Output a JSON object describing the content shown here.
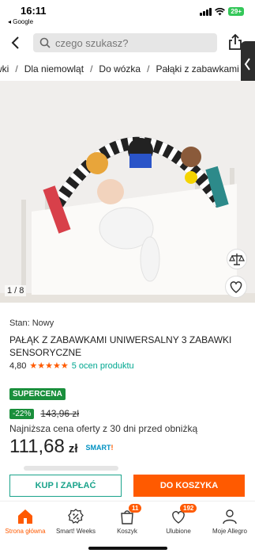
{
  "status": {
    "time": "16:11",
    "back_app": "◂ Google",
    "battery": "29+"
  },
  "search": {
    "placeholder": "czego szukasz?"
  },
  "breadcrumb": [
    "wki",
    "Dla niemowląt",
    "Do wózka",
    "Pałąki z zabawkami"
  ],
  "gallery": {
    "counter": "1 / 8"
  },
  "product": {
    "condition": "Stan: Nowy",
    "title": "PAŁĄK Z ZABAWKAMI UNIWERSALNY 3 ZABAWKI SENSORYCZNE",
    "rating": "4,80",
    "stars": "★★★★★",
    "rating_count": "5 ocen produktu",
    "supercena": "SUPERCENA",
    "discount": "-22%",
    "old_price": "143,96 zł",
    "lowest_note": "Najniższa cena oferty z 30 dni przed obniżką",
    "price": "111,68",
    "currency": "zł",
    "smart_logo": "SMART"
  },
  "actions": {
    "buy_now": "KUP I ZAPŁAĆ",
    "add_to_cart": "DO KOSZYKA"
  },
  "nav": {
    "items": [
      {
        "label": "Strona główna",
        "icon": "home-icon"
      },
      {
        "label": "Smart! Weeks",
        "icon": "smart-weeks-icon"
      },
      {
        "label": "Koszyk",
        "icon": "cart-icon",
        "badge": "11"
      },
      {
        "label": "Ulubione",
        "icon": "heart-icon",
        "badge": "192"
      },
      {
        "label": "Moje Allegro",
        "icon": "user-icon"
      }
    ]
  },
  "colors": {
    "accent": "#ff5a00",
    "green": "#1a8f3c",
    "teal": "#1aa38b"
  }
}
